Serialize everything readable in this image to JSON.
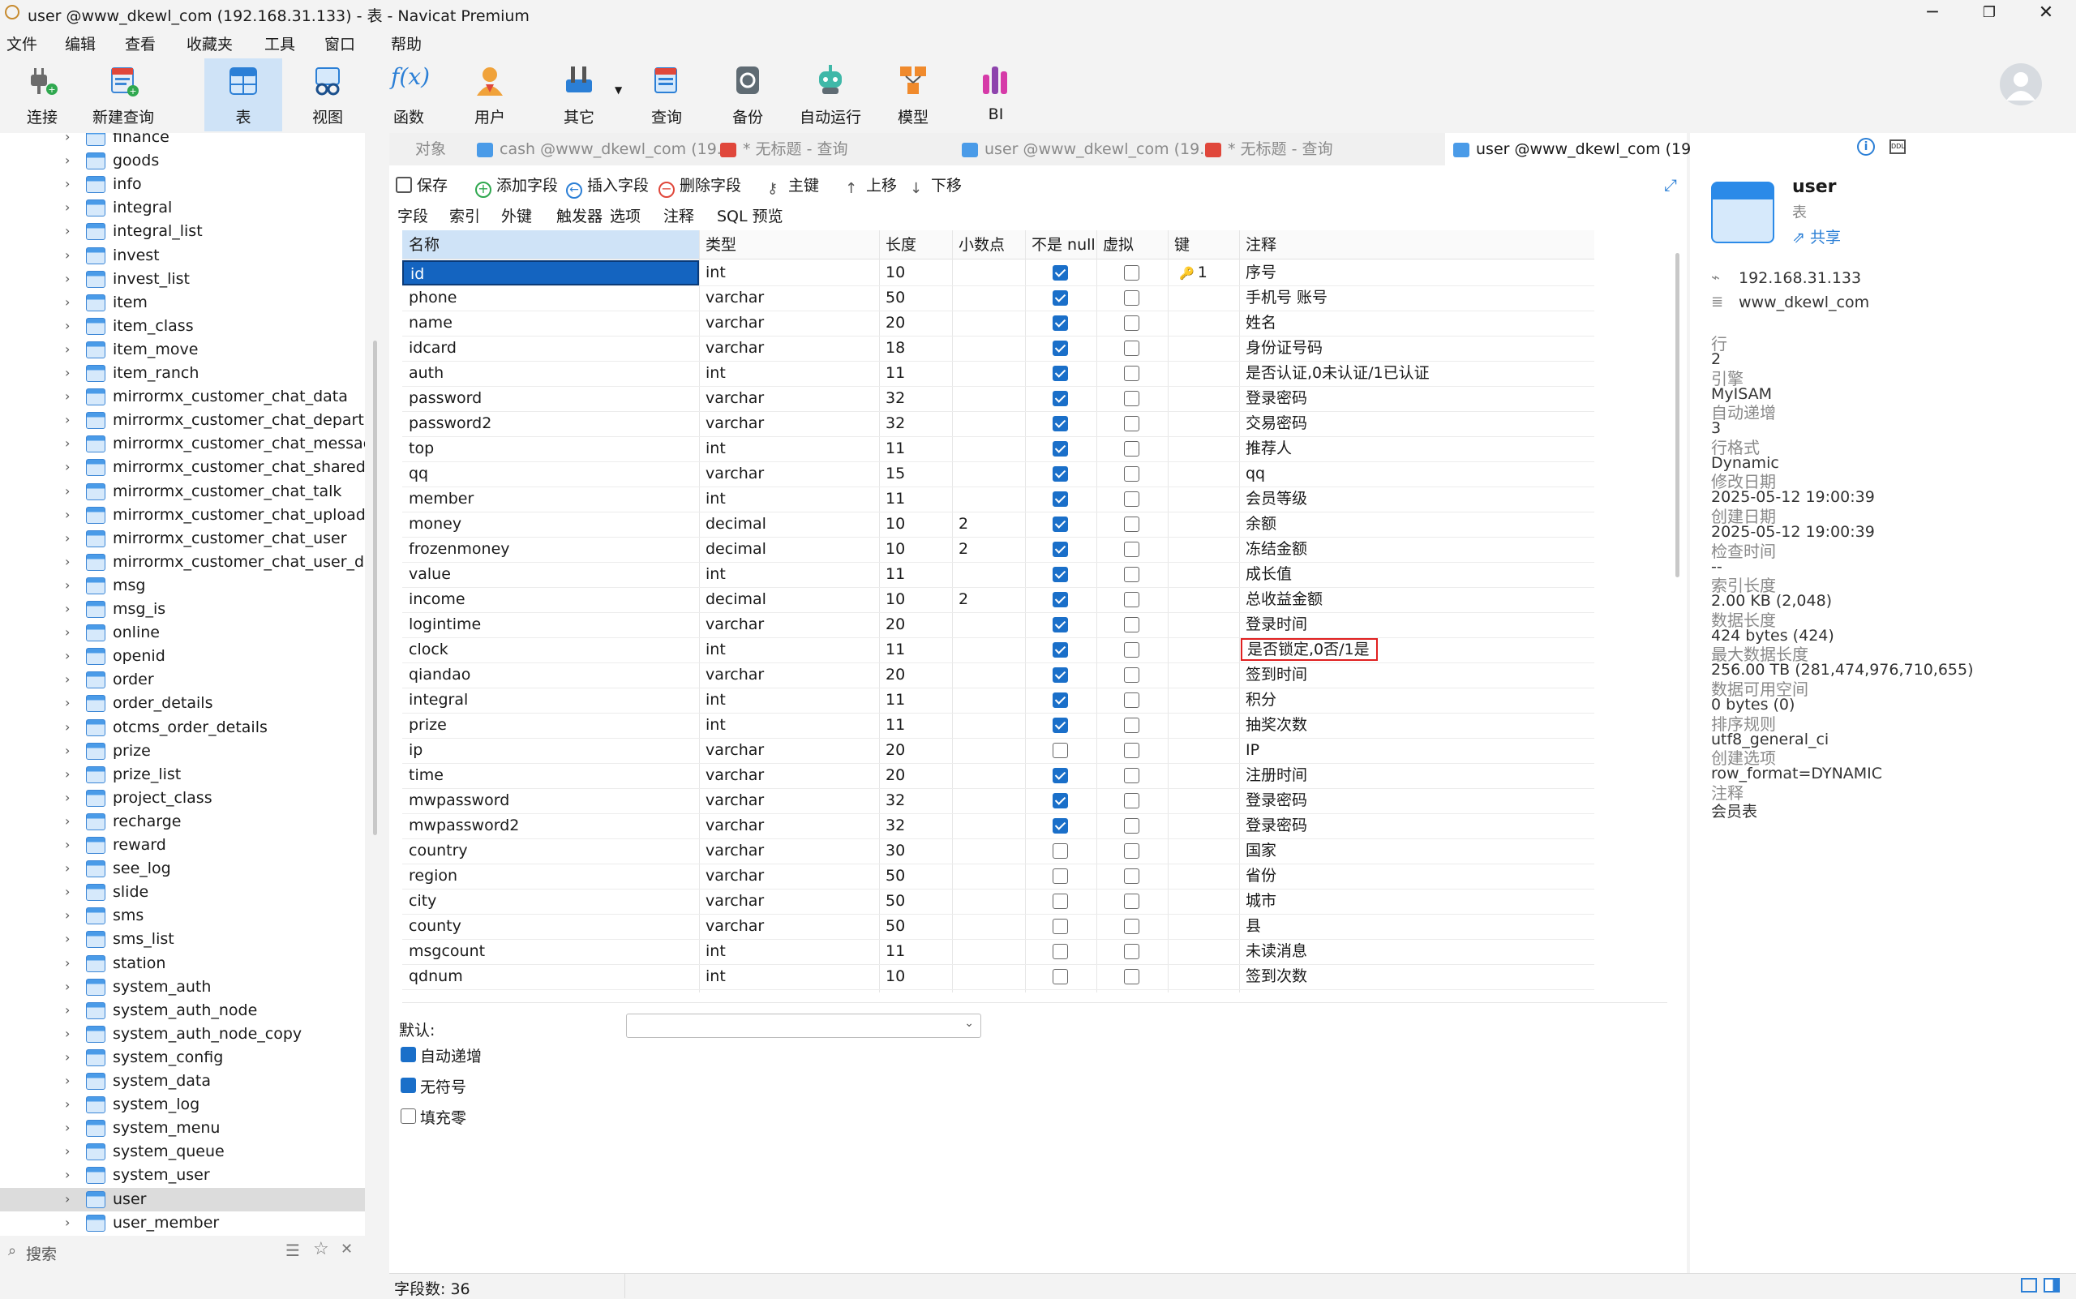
{
  "window": {
    "title": "user @www_dkewl_com (192.168.31.133) - 表 - Navicat Premium",
    "controls": [
      "─",
      "❐",
      "✕"
    ]
  },
  "menu": [
    "文件",
    "编辑",
    "查看",
    "收藏夹",
    "工具",
    "窗口",
    "帮助"
  ],
  "toolbar": {
    "items": [
      {
        "label": "连接",
        "icon": "plug-icon"
      },
      {
        "label": "新建查询",
        "icon": "new-query-icon"
      },
      {
        "label": "表",
        "icon": "table-icon"
      },
      {
        "label": "视图",
        "icon": "view-icon"
      },
      {
        "label": "函数",
        "icon": "function-icon",
        "glyph": "f(x)"
      },
      {
        "label": "用户",
        "icon": "user-icon"
      },
      {
        "label": "其它",
        "icon": "tools-icon"
      },
      {
        "label": "查询",
        "icon": "query-icon"
      },
      {
        "label": "备份",
        "icon": "backup-icon"
      },
      {
        "label": "自动运行",
        "icon": "robot-icon"
      },
      {
        "label": "模型",
        "icon": "model-icon"
      },
      {
        "label": "BI",
        "icon": "bi-icon"
      }
    ]
  },
  "sidebar": {
    "items": [
      "finance",
      "goods",
      "info",
      "integral",
      "integral_list",
      "invest",
      "invest_list",
      "item",
      "item_class",
      "item_move",
      "item_ranch",
      "mirrormx_customer_chat_data",
      "mirrormx_customer_chat_departmer",
      "mirrormx_customer_chat_message",
      "mirrormx_customer_chat_shared_file",
      "mirrormx_customer_chat_talk",
      "mirrormx_customer_chat_upload",
      "mirrormx_customer_chat_user",
      "mirrormx_customer_chat_user_depa",
      "msg",
      "msg_is",
      "online",
      "openid",
      "order",
      "order_details",
      "otcms_order_details",
      "prize",
      "prize_list",
      "project_class",
      "recharge",
      "reward",
      "see_log",
      "slide",
      "sms",
      "sms_list",
      "station",
      "system_auth",
      "system_auth_node",
      "system_auth_node_copy",
      "system_config",
      "system_data",
      "system_log",
      "system_menu",
      "system_queue",
      "system_user",
      "user",
      "user_member"
    ],
    "selected": "user",
    "search_placeholder": "搜索"
  },
  "tabs": [
    {
      "label": "对象",
      "icon": ""
    },
    {
      "label": "cash @www_dkewl_com (19...",
      "icon": "table-icon"
    },
    {
      "label": "* 无标题 - 查询",
      "icon": "query-icon"
    },
    {
      "label": "user @www_dkewl_com (19...",
      "icon": "table-icon"
    },
    {
      "label": "* 无标题 - 查询",
      "icon": "query-icon"
    },
    {
      "label": "user @www_dkewl_com (19...",
      "icon": "table-icon",
      "active": true
    }
  ],
  "editor": {
    "toolbar": [
      {
        "label": "保存",
        "icon": "save-icon"
      },
      {
        "label": "添加字段",
        "icon": "add-icon"
      },
      {
        "label": "插入字段",
        "icon": "insert-icon"
      },
      {
        "label": "删除字段",
        "icon": "delete-icon"
      },
      {
        "label": "主键",
        "icon": "key-icon"
      },
      {
        "label": "上移",
        "icon": "arrow-up-icon"
      },
      {
        "label": "下移",
        "icon": "arrow-down-icon"
      }
    ],
    "subtabs": [
      "字段",
      "索引",
      "外键",
      "触发器",
      "选项",
      "注释",
      "SQL 预览"
    ],
    "columns": [
      "名称",
      "类型",
      "长度",
      "小数点",
      "不是 null",
      "虚拟",
      "键",
      "注释"
    ],
    "fields": [
      {
        "name": "id",
        "type": "int",
        "length": "10",
        "decimals": "",
        "not_null": true,
        "virtual": false,
        "key": "1",
        "comment": "序号"
      },
      {
        "name": "phone",
        "type": "varchar",
        "length": "50",
        "decimals": "",
        "not_null": true,
        "virtual": false,
        "key": "",
        "comment": "手机号 账号"
      },
      {
        "name": "name",
        "type": "varchar",
        "length": "20",
        "decimals": "",
        "not_null": true,
        "virtual": false,
        "key": "",
        "comment": "姓名"
      },
      {
        "name": "idcard",
        "type": "varchar",
        "length": "18",
        "decimals": "",
        "not_null": true,
        "virtual": false,
        "key": "",
        "comment": "身份证号码"
      },
      {
        "name": "auth",
        "type": "int",
        "length": "11",
        "decimals": "",
        "not_null": true,
        "virtual": false,
        "key": "",
        "comment": "是否认证,0未认证/1已认证"
      },
      {
        "name": "password",
        "type": "varchar",
        "length": "32",
        "decimals": "",
        "not_null": true,
        "virtual": false,
        "key": "",
        "comment": "登录密码"
      },
      {
        "name": "password2",
        "type": "varchar",
        "length": "32",
        "decimals": "",
        "not_null": true,
        "virtual": false,
        "key": "",
        "comment": "交易密码"
      },
      {
        "name": "top",
        "type": "int",
        "length": "11",
        "decimals": "",
        "not_null": true,
        "virtual": false,
        "key": "",
        "comment": "推荐人"
      },
      {
        "name": "qq",
        "type": "varchar",
        "length": "15",
        "decimals": "",
        "not_null": true,
        "virtual": false,
        "key": "",
        "comment": "qq"
      },
      {
        "name": "member",
        "type": "int",
        "length": "11",
        "decimals": "",
        "not_null": true,
        "virtual": false,
        "key": "",
        "comment": "会员等级"
      },
      {
        "name": "money",
        "type": "decimal",
        "length": "10",
        "decimals": "2",
        "not_null": true,
        "virtual": false,
        "key": "",
        "comment": "余额"
      },
      {
        "name": "frozenmoney",
        "type": "decimal",
        "length": "10",
        "decimals": "2",
        "not_null": true,
        "virtual": false,
        "key": "",
        "comment": "冻结金额"
      },
      {
        "name": "value",
        "type": "int",
        "length": "11",
        "decimals": "",
        "not_null": true,
        "virtual": false,
        "key": "",
        "comment": "成长值"
      },
      {
        "name": "income",
        "type": "decimal",
        "length": "10",
        "decimals": "2",
        "not_null": true,
        "virtual": false,
        "key": "",
        "comment": "总收益金额"
      },
      {
        "name": "logintime",
        "type": "varchar",
        "length": "20",
        "decimals": "",
        "not_null": true,
        "virtual": false,
        "key": "",
        "comment": "登录时间"
      },
      {
        "name": "clock",
        "type": "int",
        "length": "11",
        "decimals": "",
        "not_null": true,
        "virtual": false,
        "key": "",
        "comment": "是否锁定,0否/1是",
        "highlight": true
      },
      {
        "name": "qiandao",
        "type": "varchar",
        "length": "20",
        "decimals": "",
        "not_null": true,
        "virtual": false,
        "key": "",
        "comment": "签到时间"
      },
      {
        "name": "integral",
        "type": "int",
        "length": "11",
        "decimals": "",
        "not_null": true,
        "virtual": false,
        "key": "",
        "comment": "积分"
      },
      {
        "name": "prize",
        "type": "int",
        "length": "11",
        "decimals": "",
        "not_null": true,
        "virtual": false,
        "key": "",
        "comment": "抽奖次数"
      },
      {
        "name": "ip",
        "type": "varchar",
        "length": "20",
        "decimals": "",
        "not_null": false,
        "virtual": false,
        "key": "",
        "comment": "IP"
      },
      {
        "name": "time",
        "type": "varchar",
        "length": "20",
        "decimals": "",
        "not_null": true,
        "virtual": false,
        "key": "",
        "comment": "注册时间"
      },
      {
        "name": "mwpassword",
        "type": "varchar",
        "length": "32",
        "decimals": "",
        "not_null": true,
        "virtual": false,
        "key": "",
        "comment": "登录密码"
      },
      {
        "name": "mwpassword2",
        "type": "varchar",
        "length": "32",
        "decimals": "",
        "not_null": true,
        "virtual": false,
        "key": "",
        "comment": "登录密码"
      },
      {
        "name": "country",
        "type": "varchar",
        "length": "30",
        "decimals": "",
        "not_null": false,
        "virtual": false,
        "key": "",
        "comment": "国家"
      },
      {
        "name": "region",
        "type": "varchar",
        "length": "50",
        "decimals": "",
        "not_null": false,
        "virtual": false,
        "key": "",
        "comment": "省份"
      },
      {
        "name": "city",
        "type": "varchar",
        "length": "50",
        "decimals": "",
        "not_null": false,
        "virtual": false,
        "key": "",
        "comment": "城市"
      },
      {
        "name": "county",
        "type": "varchar",
        "length": "50",
        "decimals": "",
        "not_null": false,
        "virtual": false,
        "key": "",
        "comment": "县"
      },
      {
        "name": "msgcount",
        "type": "int",
        "length": "11",
        "decimals": "",
        "not_null": false,
        "virtual": false,
        "key": "",
        "comment": "未读消息"
      },
      {
        "name": "qdnum",
        "type": "int",
        "length": "10",
        "decimals": "",
        "not_null": false,
        "virtual": false,
        "key": "",
        "comment": "签到次数"
      }
    ],
    "props": {
      "default_label": "默认:",
      "auto_increment": {
        "label": "自动递增",
        "checked": true
      },
      "unsigned": {
        "label": "无符号",
        "checked": true
      },
      "zerofill": {
        "label": "填充零",
        "checked": false
      }
    }
  },
  "statusbar": {
    "field_count": "字段数: 36"
  },
  "right_panel": {
    "title": "user",
    "subtitle": "表",
    "share": "共享",
    "host": "192.168.31.133",
    "database": "www_dkewl_com",
    "props": [
      {
        "label": "行",
        "value": "2"
      },
      {
        "label": "引擎",
        "value": "MyISAM"
      },
      {
        "label": "自动递增",
        "value": "3"
      },
      {
        "label": "行格式",
        "value": "Dynamic"
      },
      {
        "label": "修改日期",
        "value": "2025-05-12 19:00:39"
      },
      {
        "label": "创建日期",
        "value": "2025-05-12 19:00:39"
      },
      {
        "label": "检查时间",
        "value": "--"
      },
      {
        "label": "索引长度",
        "value": "2.00 KB (2,048)"
      },
      {
        "label": "数据长度",
        "value": "424 bytes (424)"
      },
      {
        "label": "最大数据长度",
        "value": "256.00 TB (281,474,976,710,655)"
      },
      {
        "label": "数据可用空间",
        "value": "0 bytes (0)"
      },
      {
        "label": "排序规则",
        "value": "utf8_general_ci"
      },
      {
        "label": "创建选项",
        "value": "row_format=DYNAMIC"
      },
      {
        "label": "注释",
        "value": "会员表"
      }
    ]
  },
  "colors": {
    "accent": "#1a6fc9",
    "selection": "#cfe3f7",
    "highlight_border": "#e02020"
  }
}
